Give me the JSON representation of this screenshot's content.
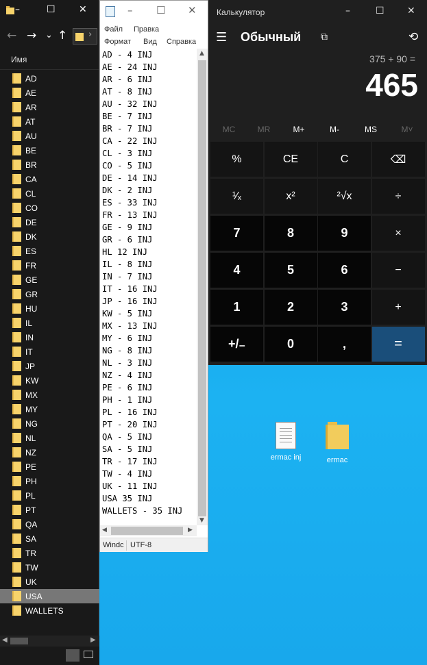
{
  "explorer": {
    "column_header": "Имя",
    "folders": [
      "AD",
      "AE",
      "AR",
      "AT",
      "AU",
      "BE",
      "BR",
      "CA",
      "CL",
      "CO",
      "DE",
      "DK",
      "ES",
      "FR",
      "GE",
      "GR",
      "HU",
      "IL",
      "IN",
      "IT",
      "JP",
      "KW",
      "MX",
      "MY",
      "NG",
      "NL",
      "NZ",
      "PE",
      "PH",
      "PL",
      "PT",
      "QA",
      "SA",
      "TR",
      "TW",
      "UK",
      "USA",
      "WALLETS"
    ],
    "selected": "USA",
    "title_buttons": {
      "minimize": "–",
      "maximize": "☐",
      "close": "✕"
    },
    "nav": {
      "back": "←",
      "forward": "→",
      "dropdown": "⌄",
      "up": "↑",
      "crumb_arrow": "›"
    }
  },
  "notepad": {
    "menu": {
      "file": "Файл",
      "edit": "Правка",
      "format": "Формат",
      "view": "Вид",
      "help": "Справка"
    },
    "lines": [
      "AD - 4 INJ",
      "AE - 24 INJ",
      "AR - 6 INJ",
      "AT - 8 INJ",
      "AU - 32 INJ",
      "BE - 7 INJ",
      "BR - 7 INJ",
      "CA - 22 INJ",
      "CL - 3 INJ",
      "CO - 5 INJ",
      "DE - 14 INJ",
      "DK - 2 INJ",
      "ES - 33 INJ",
      "FR - 13 INJ",
      "GE - 9 INJ",
      "GR - 6 INJ",
      "HL 12 INJ",
      "IL - 8 INJ",
      "IN - 7 INJ",
      "IT - 16 INJ",
      "JP - 16 INJ",
      "KW - 5 INJ",
      "MX - 13 INJ",
      "MY - 6 INJ",
      "NG - 8 INJ",
      "NL - 3 INJ",
      "NZ - 4 INJ",
      "PE - 6 INJ",
      "PH - 1 INJ",
      "PL - 16 INJ",
      "PT - 20 INJ",
      "QA - 5 INJ",
      "SA - 5 INJ",
      "TR - 17 INJ",
      "TW - 4 INJ",
      "UK - 11 INJ",
      "USA 35 INJ",
      "WALLETS - 35 INJ"
    ],
    "status_left": "Windc",
    "status_encoding": "UTF-8",
    "title_buttons": {
      "minimize": "–",
      "maximize": "☐",
      "close": "✕"
    }
  },
  "calculator": {
    "title": "Калькулятор",
    "mode": "Обычный",
    "expression": "375 + 90 =",
    "display": "465",
    "memory": [
      "MC",
      "MR",
      "M+",
      "M-",
      "MS",
      "M˅"
    ],
    "keys": [
      [
        "%",
        "CE",
        "C",
        "⌫"
      ],
      [
        "¹⁄ₓ",
        "x²",
        "²√x",
        "÷"
      ],
      [
        "7",
        "8",
        "9",
        "×"
      ],
      [
        "4",
        "5",
        "6",
        "−"
      ],
      [
        "1",
        "2",
        "3",
        "+"
      ],
      [
        "+/₋",
        "0",
        ",",
        "="
      ]
    ],
    "title_buttons": {
      "minimize": "–",
      "maximize": "☐",
      "close": "✕"
    },
    "icons": {
      "menu": "☰",
      "keep_on_top": "⧉",
      "history": "⟲"
    }
  },
  "desktop": {
    "icons": [
      {
        "label": "ermac inj",
        "type": "text-file-icon"
      },
      {
        "label": "ermac",
        "type": "folder-icon"
      }
    ]
  },
  "colors": {
    "desktop": "#1aa3e8",
    "calc_bg": "#1f1f1f",
    "equals": "#1a4e7a",
    "folder": "#f7d36b"
  }
}
